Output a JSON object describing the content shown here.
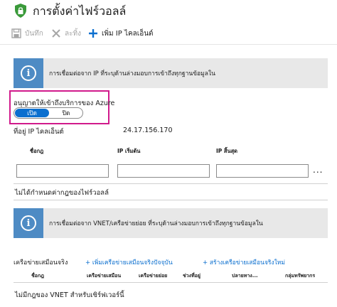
{
  "window": {
    "title": "การตั้งค่าไฟร์วอลล์"
  },
  "toolbar": {
    "save_label": "บันทึก",
    "discard_label": "ละทิ้ง",
    "add_client_ip_label": "เพิ่ม IP ไคลเอ็นต์"
  },
  "info1": {
    "text": "การเชื่อมต่อจาก IP ที่ระบุด้านล่างมอบการเข้าถึงทุกฐานข้อมูลใน"
  },
  "allow_azure": {
    "label": "อนุญาตให้เข้าถึงบริการของ Azure",
    "on_label": "เปิด",
    "off_label": "ปิด",
    "selected": "เปิด"
  },
  "client_ip": {
    "label": "ที่อยู่ IP ไคลเอ็นต์",
    "value": "24.17.156.170"
  },
  "rules": {
    "columns": [
      "ชื่อกฎ",
      "IP เริ่มต้น",
      "IP สิ้นสุด"
    ],
    "new_row": {
      "name": "",
      "start_ip": "",
      "end_ip": ""
    },
    "more": "...",
    "empty_text": "ไม่ได้กำหนดค่ากฎของไฟร์วอลล์"
  },
  "info2": {
    "text": "การเชื่อมต่อจาก VNET/เครือข่ายย่อย ที่ระบุด้านล่างมอบการเข้าถึงทุกฐานข้อมูลใน"
  },
  "vnet": {
    "label": "เครือข่ายเสมือนจริง",
    "add_existing_link": "+ เพิ่มเครือข่ายเสมือนจริงปัจจุบัน",
    "create_new_link": "+ สร้างเครือข่ายเสมือนจริงใหม่",
    "columns": [
      "ชื่อกฎ",
      "เครือข่ายเสมือน",
      "เครือข่ายย่อย",
      "ช่วงที่อยู่",
      "ปลายทาง...",
      "กลุ่มทรัพยากร"
    ],
    "empty_text": "ไม่มีกฎของ VNET สำหรับเซิร์ฟเวอร์นี้"
  },
  "colors": {
    "accent": "#0b6fcf",
    "shield": "#3a9a3a",
    "info_icon_bg": "#4e8bc4",
    "info_bar_bg": "#e8e8e8",
    "highlight": "#d11a8c"
  }
}
